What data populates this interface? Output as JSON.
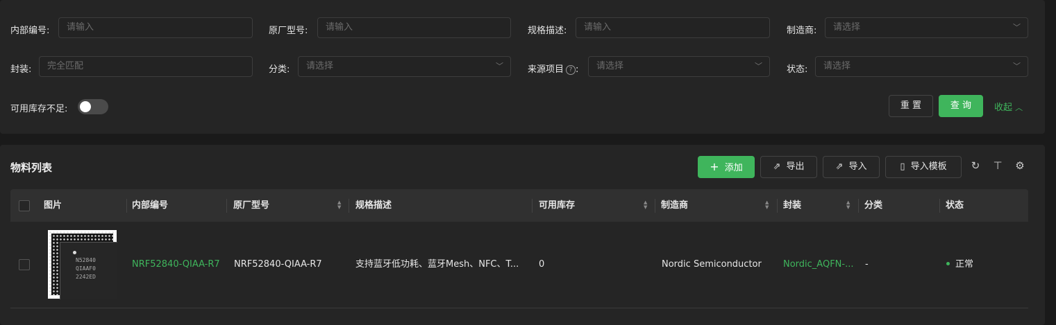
{
  "filters": {
    "internal_code": {
      "label": "内部编号:",
      "placeholder": "请输入"
    },
    "mfr_part": {
      "label": "原厂型号:",
      "placeholder": "请输入"
    },
    "spec": {
      "label": "规格描述:",
      "placeholder": "请输入"
    },
    "manufacturer": {
      "label": "制造商:",
      "placeholder": "请选择"
    },
    "package": {
      "label": "封装:",
      "placeholder": "完全匹配"
    },
    "category": {
      "label": "分类:",
      "placeholder": "请选择"
    },
    "source_project": {
      "label": "来源项目",
      "colon": ":",
      "placeholder": "请选择",
      "help_icon": "?"
    },
    "status": {
      "label": "状态:",
      "placeholder": "请选择"
    },
    "low_stock": {
      "label": "可用库存不足:",
      "enabled": false
    }
  },
  "actions": {
    "reset": "重 置",
    "query": "查 询",
    "collapse": "收起",
    "collapse_icon": "chevron-up-icon"
  },
  "list": {
    "title": "物料列表",
    "toolbar": {
      "add": "添加",
      "export": "导出",
      "import": "导入",
      "import_template": "导入模板",
      "icons": [
        "refresh-icon",
        "column-height-icon",
        "settings-icon"
      ]
    },
    "columns": [
      "图片",
      "内部编号",
      "原厂型号",
      "规格描述",
      "可用库存",
      "制造商",
      "封装",
      "分类",
      "状态"
    ],
    "rows": [
      {
        "image_marking": [
          "N52840",
          "QIAAF0",
          "2242ED"
        ],
        "internal_code": "NRF52840-QIAA-R7",
        "mfr_part": "NRF52840-QIAA-R7",
        "spec": "支持蓝牙低功耗、蓝牙Mesh、NFC、T...",
        "stock": "0",
        "manufacturer": "Nordic Semiconductor",
        "package": "Nordic_AQFN-...",
        "category": "-",
        "status": "正常"
      }
    ]
  },
  "colors": {
    "accent": "#3fb55c",
    "background": "#1a1a1a",
    "panel": "#252525",
    "header": "#303030"
  }
}
